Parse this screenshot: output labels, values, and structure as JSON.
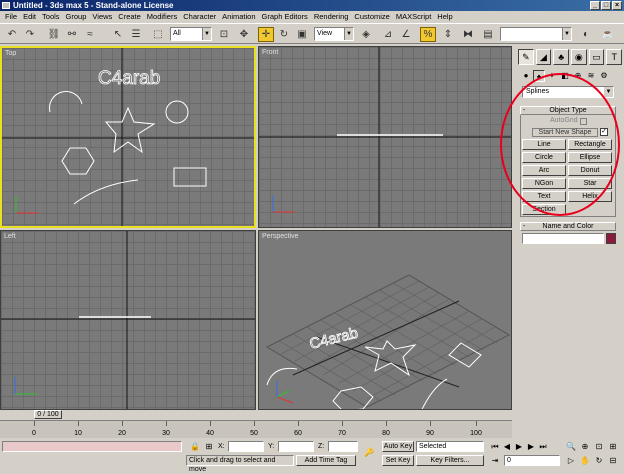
{
  "window": {
    "title": "Untitled - 3ds max 5 - Stand-alone License",
    "min": "_",
    "max": "□",
    "close": "×"
  },
  "menu": [
    "File",
    "Edit",
    "Tools",
    "Group",
    "Views",
    "Create",
    "Modifiers",
    "Character",
    "Animation",
    "Graph Editors",
    "Rendering",
    "Customize",
    "MAXScript",
    "Help"
  ],
  "toolbar": {
    "selection_filter": "All",
    "ref_coord": "View"
  },
  "viewports": {
    "top": "Top",
    "front": "Front",
    "left": "Left",
    "perspective": "Perspective",
    "scene_text": "C4arab"
  },
  "command_panel": {
    "category": "Splines",
    "object_type_header": "Object Type",
    "autogrid": "AutoGrid",
    "start_new_shape": "Start New Shape",
    "check": "✓",
    "buttons": [
      "Line",
      "Rectangle",
      "Circle",
      "Ellipse",
      "Arc",
      "Donut",
      "NGon",
      "Star",
      "Text",
      "Helix",
      "Section"
    ],
    "name_color_header": "Name and Color",
    "collapse": "-",
    "swatch_color": "#8c1a3c"
  },
  "timeline": {
    "slider": "0 / 100",
    "ticks": [
      "0",
      "10",
      "20",
      "30",
      "40",
      "50",
      "60",
      "70",
      "80",
      "90",
      "100"
    ]
  },
  "status": {
    "x_label": "X:",
    "y_label": "Y:",
    "z_label": "Z:",
    "autokey": "Auto Key",
    "setkey": "Set Key",
    "selected": "Selected",
    "keyfilters": "Key Filters...",
    "prompt": "Click and drag to select and move",
    "addtimetag": "Add Time Tag",
    "frame": "0"
  },
  "highlight_color": "#e8001c"
}
